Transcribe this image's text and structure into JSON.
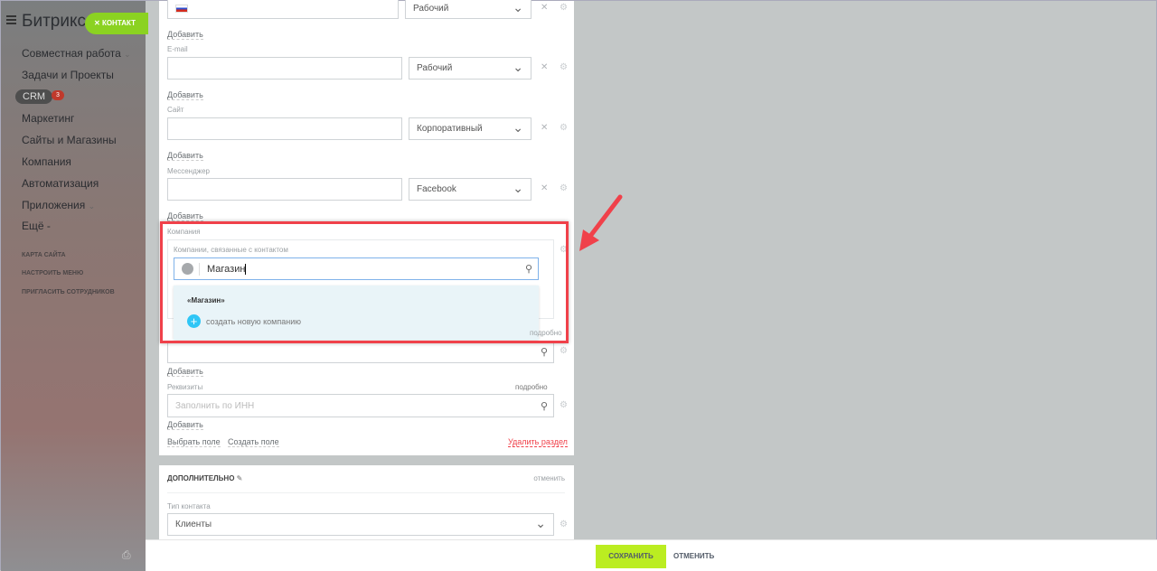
{
  "sidebar": {
    "logo": "Битрикс",
    "contact_button": "КОНТАКТ",
    "items": [
      "Совместная работа",
      "Задачи и Проекты",
      "CRM",
      "Маркетинг",
      "Сайты и Магазины",
      "Компания",
      "Автоматизация",
      "Приложения",
      "Ещё -"
    ],
    "crm_badge": "3",
    "links": [
      "КАРТА САЙТА",
      "НАСТРОИТЬ МЕНЮ",
      "ПРИГЛАСИТЬ СОТРУДНИКОВ"
    ]
  },
  "form": {
    "add": "Добавить",
    "phone": {
      "type": "Рабочий"
    },
    "email": {
      "label": "E-mail",
      "type": "Рабочий"
    },
    "site": {
      "label": "Сайт",
      "type": "Корпоративный"
    },
    "messenger": {
      "label": "Мессенджер",
      "type": "Facebook"
    },
    "company": {
      "label": "Компания",
      "inner_label": "Компании, связанные с контактом",
      "search_value": "Магазин",
      "suggestion": "«Магазин»",
      "create": "создать новую компанию"
    },
    "address": {
      "details": "подробно"
    },
    "requisites": {
      "label": "Реквизиты",
      "details": "подробно",
      "placeholder": "Заполнить по ИНН"
    },
    "choose_field": "Выбрать поле",
    "create_field": "Создать поле",
    "delete_section": "Удалить раздел"
  },
  "additional": {
    "title": "ДОПОЛНИТЕЛЬНО",
    "cancel": "отменить",
    "contact_type_label": "Тип контакта",
    "contact_type": "Клиенты"
  },
  "footer": {
    "save": "СОХРАНИТЬ",
    "cancel": "ОТМЕНИТЬ"
  },
  "colors": {
    "accent_green": "#bbed21",
    "highlight_red": "#f0414a",
    "plus_blue": "#2fc6f6"
  }
}
